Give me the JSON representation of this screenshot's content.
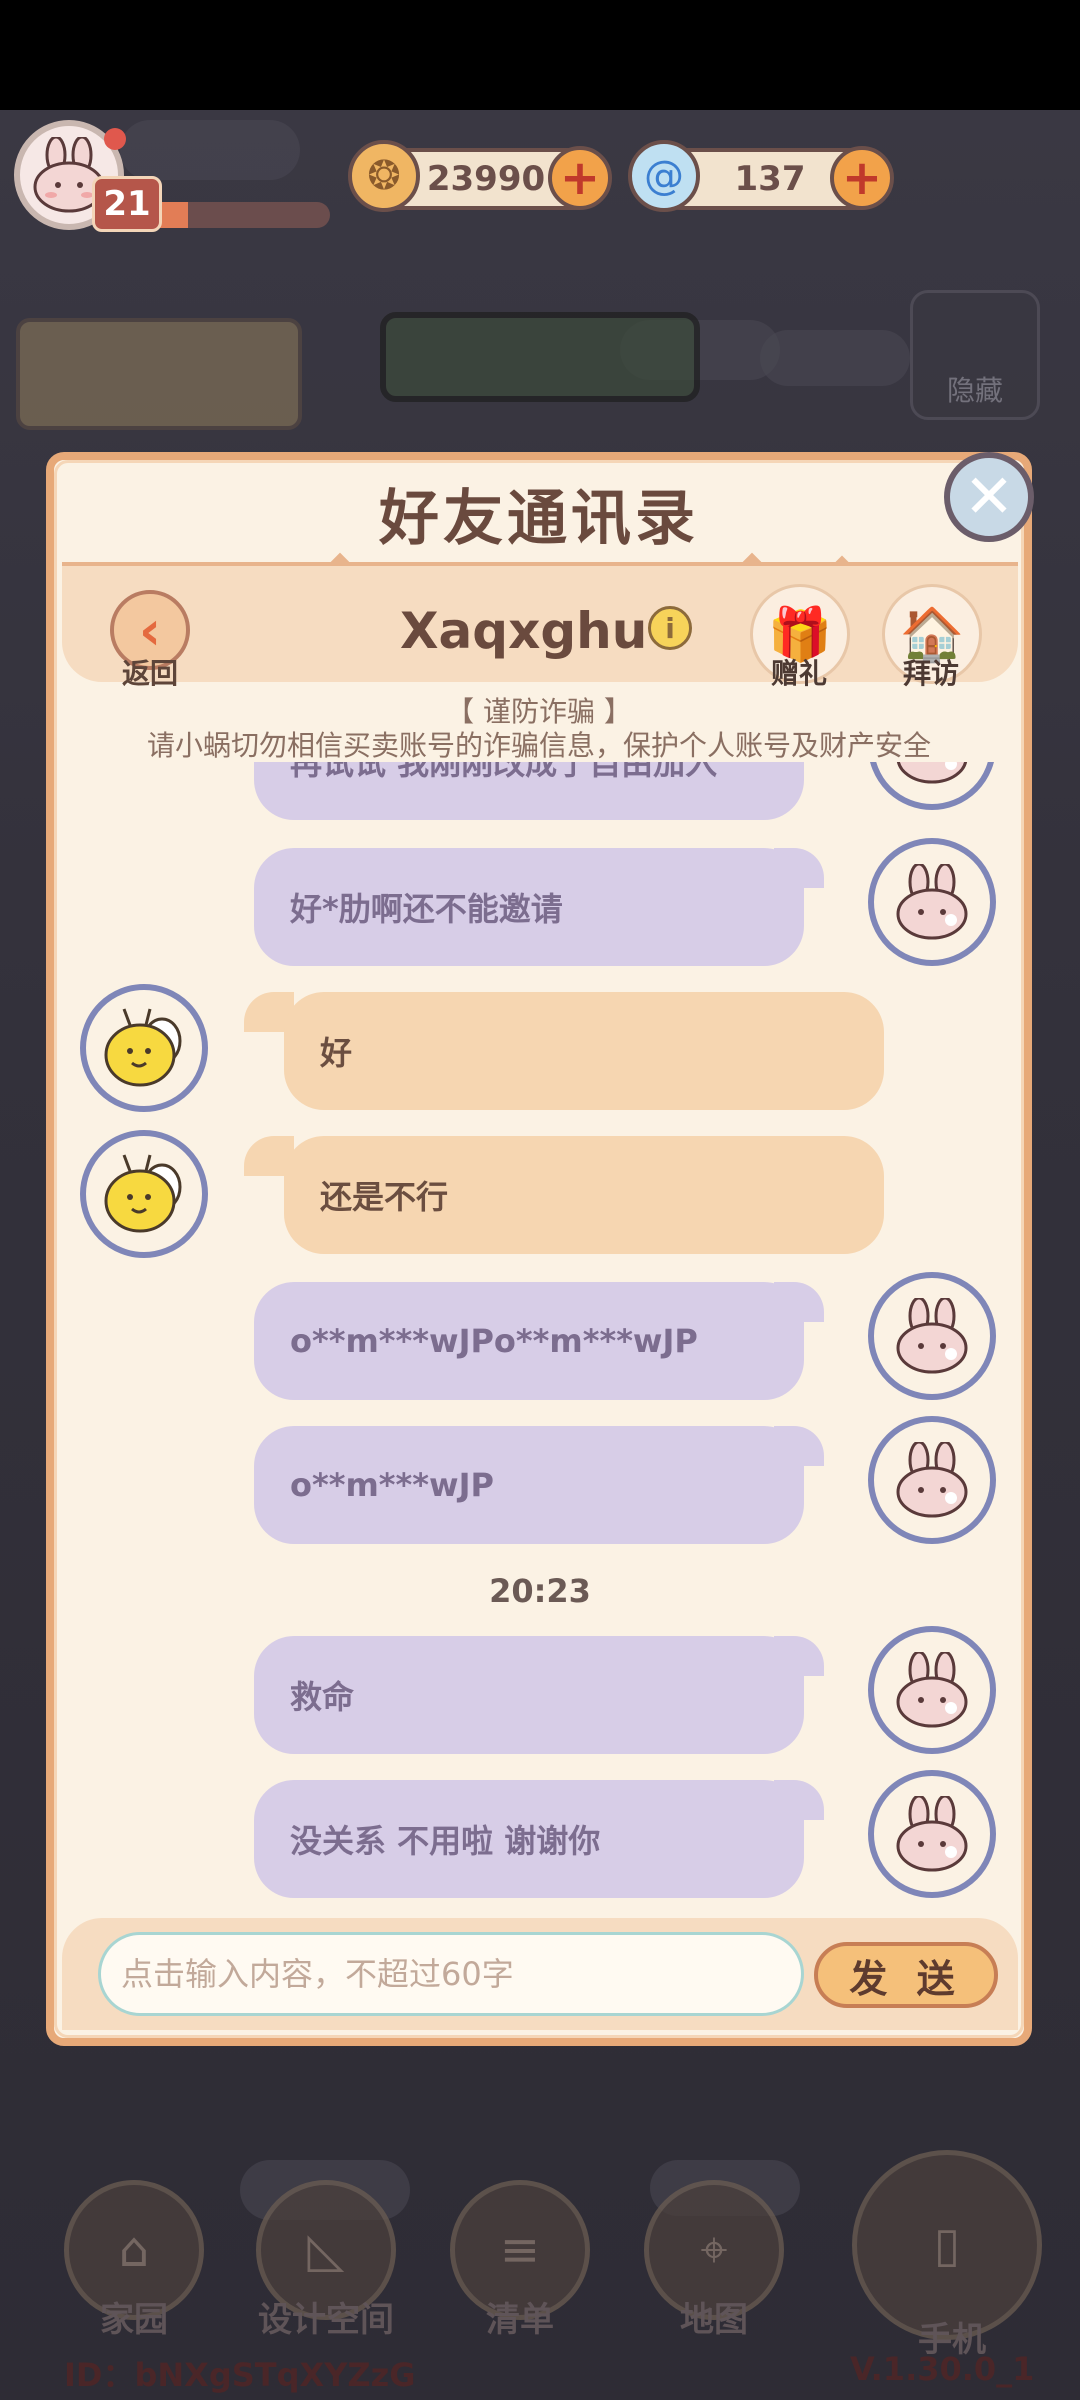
{
  "hud": {
    "level": "21",
    "xp_progress": 0.25,
    "coins": "23990",
    "gems": "137",
    "coin_icon": "coin-icon",
    "gem_icon": "swirl-gem-icon"
  },
  "background": {
    "hide_label": "隐藏",
    "nav": [
      {
        "label": "家园",
        "icon": "house-icon"
      },
      {
        "label": "设计空间",
        "icon": "ruler-icon"
      },
      {
        "label": "清单",
        "icon": "list-icon"
      },
      {
        "label": "地图",
        "icon": "map-pin-icon"
      },
      {
        "label": "手机",
        "icon": "phone-icon"
      }
    ],
    "user_id": "ID：bNXgSTqXYZzG",
    "version": "V.1.30.0_1"
  },
  "dialog": {
    "title": "好友通讯录",
    "back_label": "返回",
    "friend_name": "Xaqxghu",
    "gift_label": "赠礼",
    "visit_label": "拜访",
    "warning_title": "【 谨防诈骗 】",
    "warning_text": "请小蜗切勿相信买卖账号的诈骗信息，保护个人账号及财产安全"
  },
  "chat": {
    "messages": [
      {
        "from": "me",
        "text": "再试试 我刚刚改成了自由加入"
      },
      {
        "from": "me",
        "text": "好*肋啊还不能邀请"
      },
      {
        "from": "friend",
        "text": "好"
      },
      {
        "from": "friend",
        "text": "还是不行"
      },
      {
        "from": "me",
        "text": "o**m***wJPo**m***wJP"
      },
      {
        "from": "me",
        "text": "o**m***wJP"
      },
      {
        "from": "me",
        "text": "救命"
      },
      {
        "from": "me",
        "text": "没关系 不用啦 谢谢你"
      }
    ],
    "timestamp": "20:23"
  },
  "input": {
    "placeholder": "点击输入内容，不超过60字",
    "send_label": "发 送"
  }
}
